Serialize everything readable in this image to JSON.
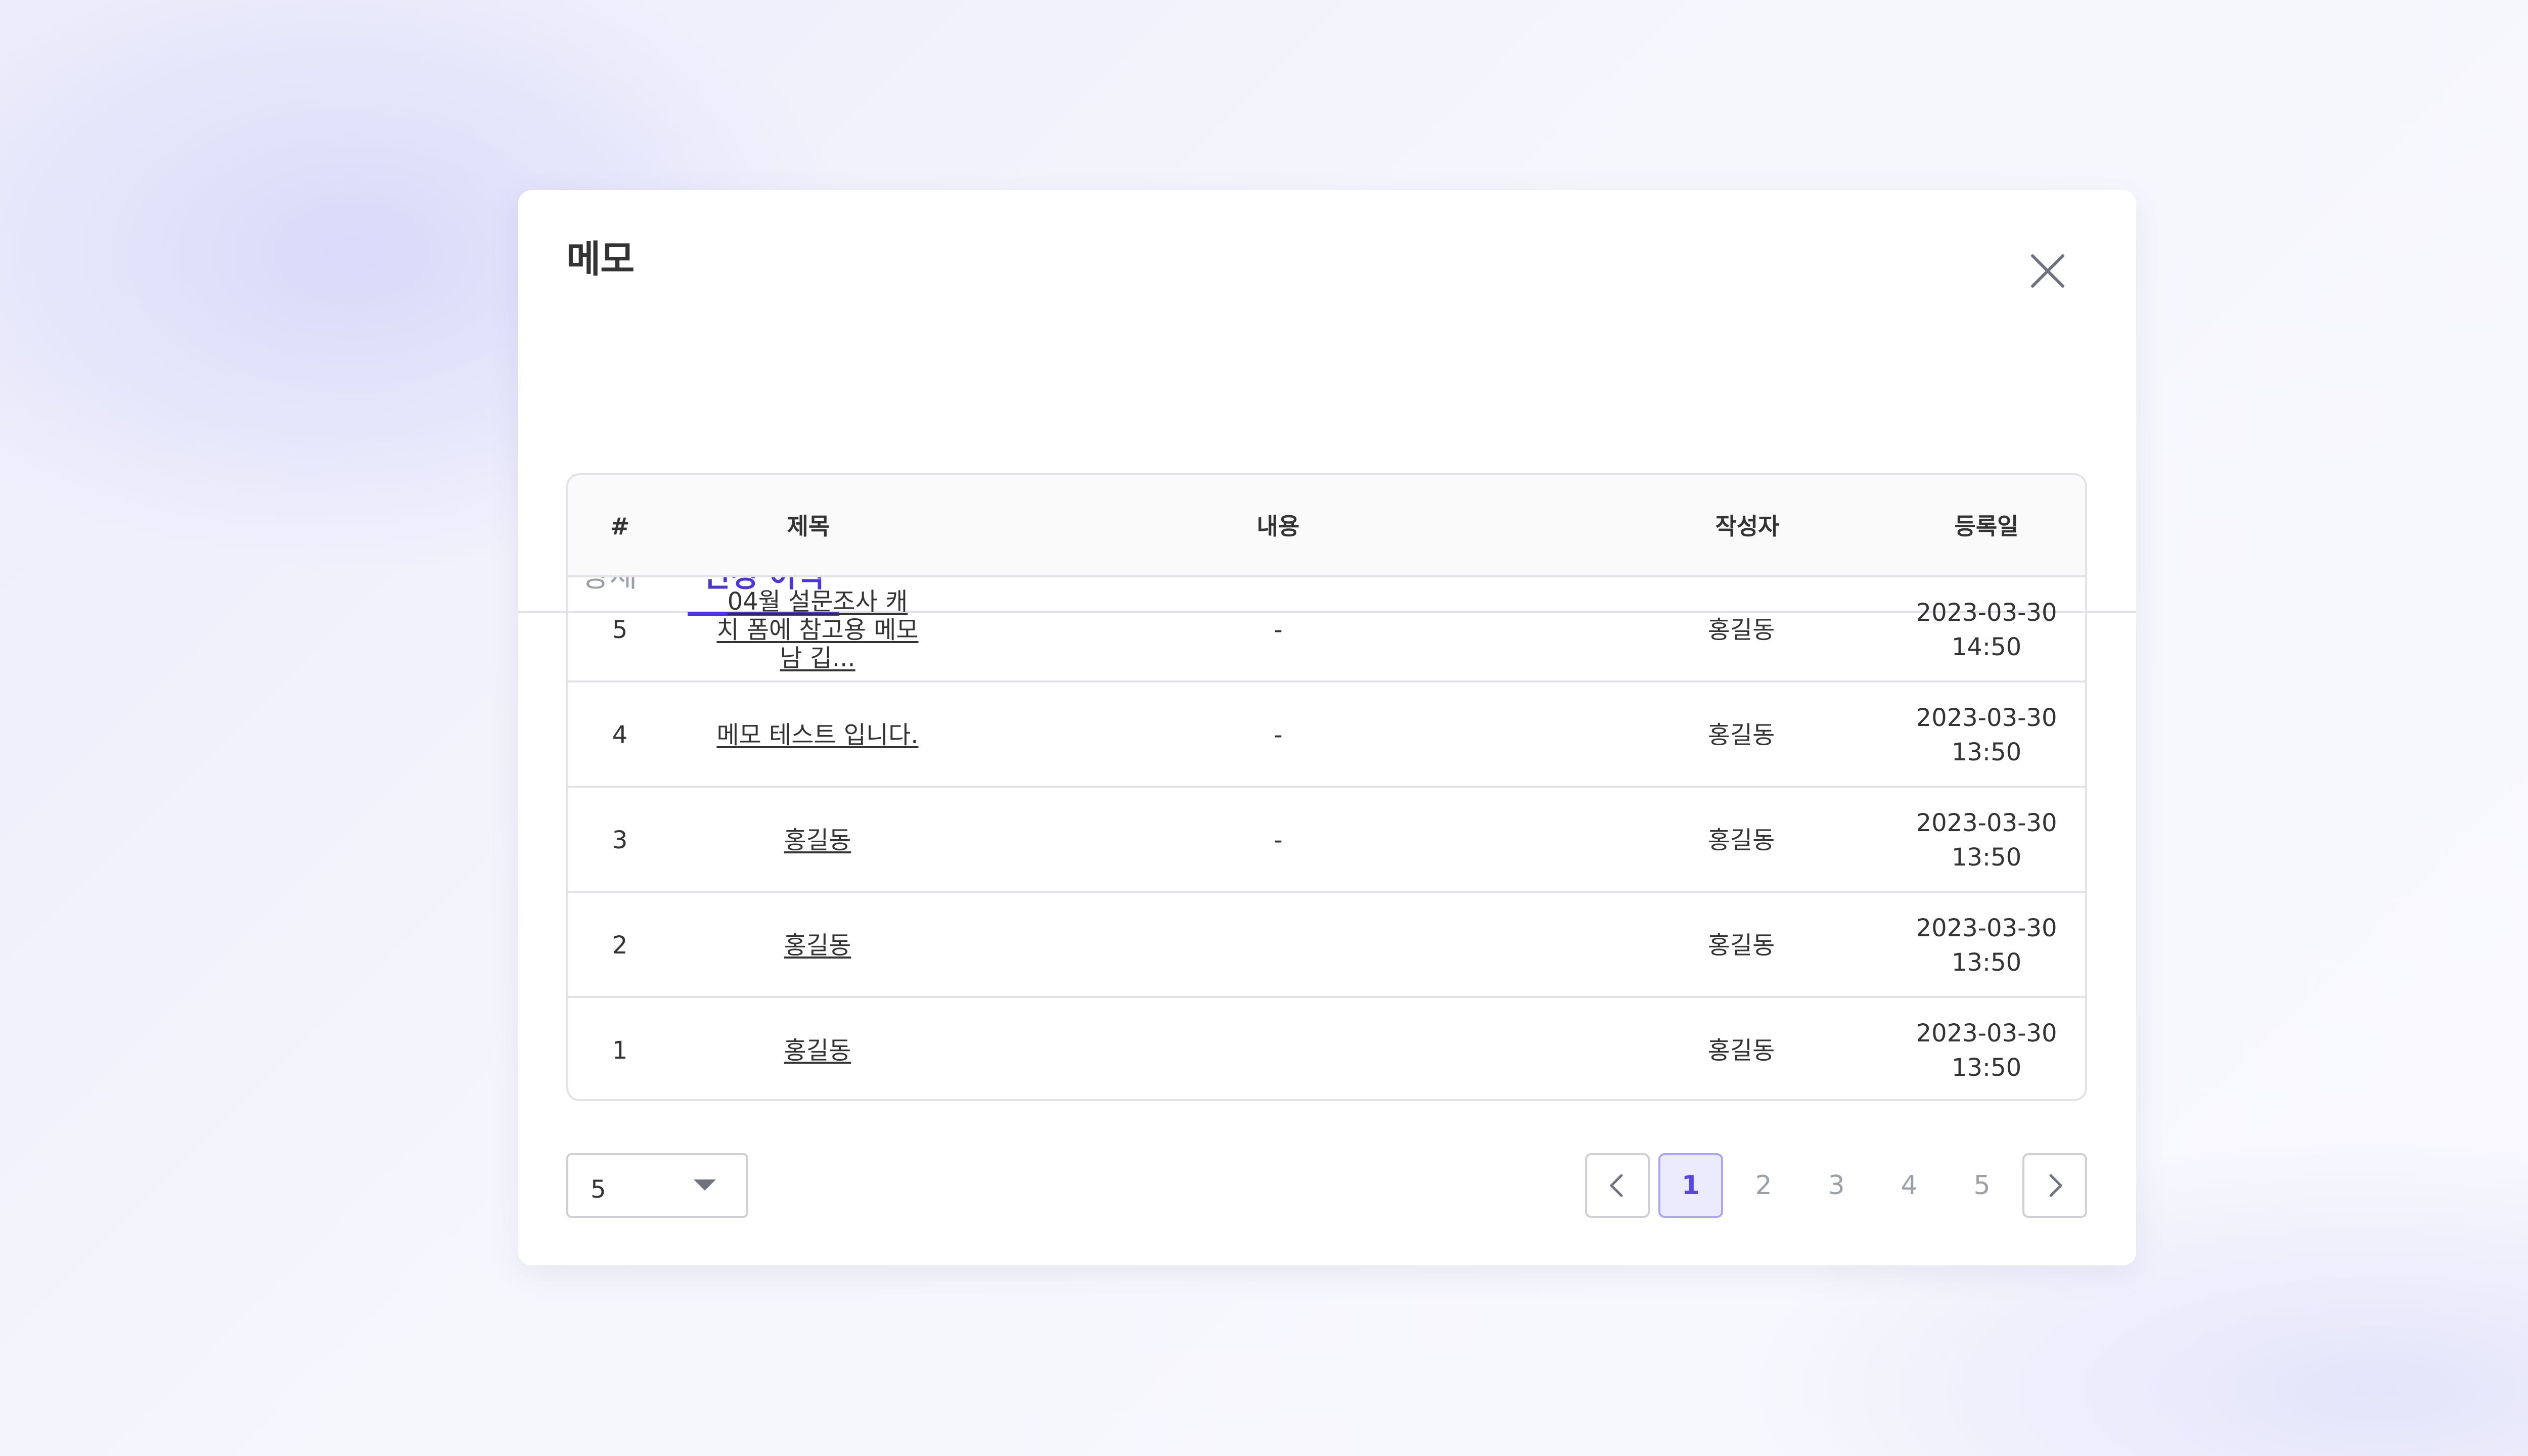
{
  "modal": {
    "title": "메모",
    "tabs": [
      {
        "label": "상세",
        "active": false
      },
      {
        "label": "변경 이력",
        "active": true
      }
    ]
  },
  "table": {
    "headers": [
      "#",
      "제목",
      "내용",
      "작성자",
      "등록일"
    ],
    "rows": [
      {
        "no": "5",
        "title": "04월 설문조사 캐치 폼에 참고용 메모남 깁...",
        "content": "-",
        "author": "홍길동",
        "date": "2023-03-30",
        "time": "14:50"
      },
      {
        "no": "4",
        "title": "메모 테스트 입니다.",
        "content": "-",
        "author": "홍길동",
        "date": "2023-03-30",
        "time": "13:50"
      },
      {
        "no": "3",
        "title": "홍길동",
        "content": "-",
        "author": "홍길동",
        "date": "2023-03-30",
        "time": "13:50"
      },
      {
        "no": "2",
        "title": "홍길동",
        "content": "",
        "author": "홍길동",
        "date": "2023-03-30",
        "time": "13:50"
      },
      {
        "no": "1",
        "title": "홍길동",
        "content": "",
        "author": "홍길동",
        "date": "2023-03-30",
        "time": "13:50"
      }
    ]
  },
  "pagination": {
    "page_size": "5",
    "pages": [
      "1",
      "2",
      "3",
      "4",
      "5"
    ],
    "current_page": "1"
  },
  "colors": {
    "accent": "#4a35e0",
    "active_page_bg": "#ebebfd",
    "border": "#e2e2e8",
    "muted_text": "#9aa0a8"
  },
  "icons": {
    "close": "close-icon",
    "prev": "chevron-left-icon",
    "next": "chevron-right-icon",
    "dropdown": "caret-down-icon"
  }
}
